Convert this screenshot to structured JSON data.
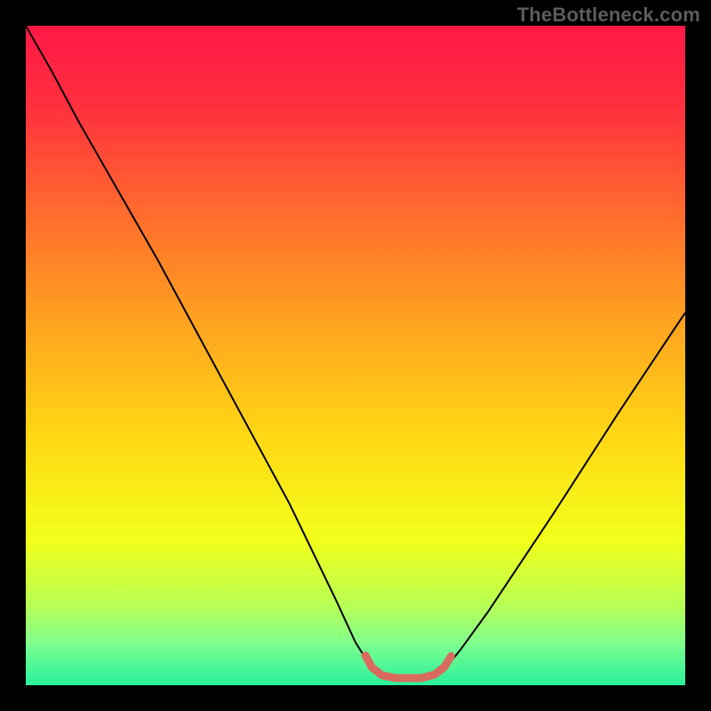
{
  "watermark": "TheBottleneck.com",
  "chart_data": {
    "type": "line",
    "title": "",
    "xlabel": "",
    "ylabel": "",
    "xlim": [
      0,
      100
    ],
    "ylim": [
      0,
      100
    ],
    "background": {
      "kind": "vertical-gradient",
      "stops": [
        {
          "pos": 0.0,
          "color": "#ff1846"
        },
        {
          "pos": 0.12,
          "color": "#ff2f3e"
        },
        {
          "pos": 0.28,
          "color": "#ff6a2e"
        },
        {
          "pos": 0.45,
          "color": "#ffa320"
        },
        {
          "pos": 0.62,
          "color": "#ffd714"
        },
        {
          "pos": 0.78,
          "color": "#f2ff1a"
        },
        {
          "pos": 0.88,
          "color": "#b7ff55"
        },
        {
          "pos": 0.94,
          "color": "#7dff90"
        },
        {
          "pos": 1.0,
          "color": "#2cf5a0"
        }
      ]
    },
    "series": [
      {
        "name": "bottleneck-curve",
        "color": "#000000",
        "width": 2,
        "points": [
          {
            "x": 0.0,
            "y": 100.0
          },
          {
            "x": 4.0,
            "y": 93.0
          },
          {
            "x": 8.0,
            "y": 85.5
          },
          {
            "x": 10.0,
            "y": 82.0
          },
          {
            "x": 20.0,
            "y": 64.5
          },
          {
            "x": 30.0,
            "y": 46.0
          },
          {
            "x": 40.0,
            "y": 27.5
          },
          {
            "x": 47.0,
            "y": 13.0
          },
          {
            "x": 50.0,
            "y": 6.5
          },
          {
            "x": 52.5,
            "y": 2.5
          },
          {
            "x": 54.0,
            "y": 1.2
          },
          {
            "x": 56.0,
            "y": 0.8
          },
          {
            "x": 58.0,
            "y": 0.8
          },
          {
            "x": 60.0,
            "y": 0.8
          },
          {
            "x": 62.0,
            "y": 1.3
          },
          {
            "x": 64.0,
            "y": 3.0
          },
          {
            "x": 66.0,
            "y": 5.5
          },
          {
            "x": 70.0,
            "y": 11.0
          },
          {
            "x": 80.0,
            "y": 26.0
          },
          {
            "x": 90.0,
            "y": 41.5
          },
          {
            "x": 100.0,
            "y": 56.5
          }
        ]
      },
      {
        "name": "optimal-band-marker",
        "color": "#d96b5e",
        "width": 9,
        "points": [
          {
            "x": 51.5,
            "y": 4.5
          },
          {
            "x": 52.5,
            "y": 2.7
          },
          {
            "x": 54.0,
            "y": 1.5
          },
          {
            "x": 56.0,
            "y": 1.1
          },
          {
            "x": 58.0,
            "y": 1.1
          },
          {
            "x": 60.0,
            "y": 1.1
          },
          {
            "x": 62.0,
            "y": 1.6
          },
          {
            "x": 63.5,
            "y": 2.8
          },
          {
            "x": 64.5,
            "y": 4.4
          }
        ]
      }
    ]
  }
}
